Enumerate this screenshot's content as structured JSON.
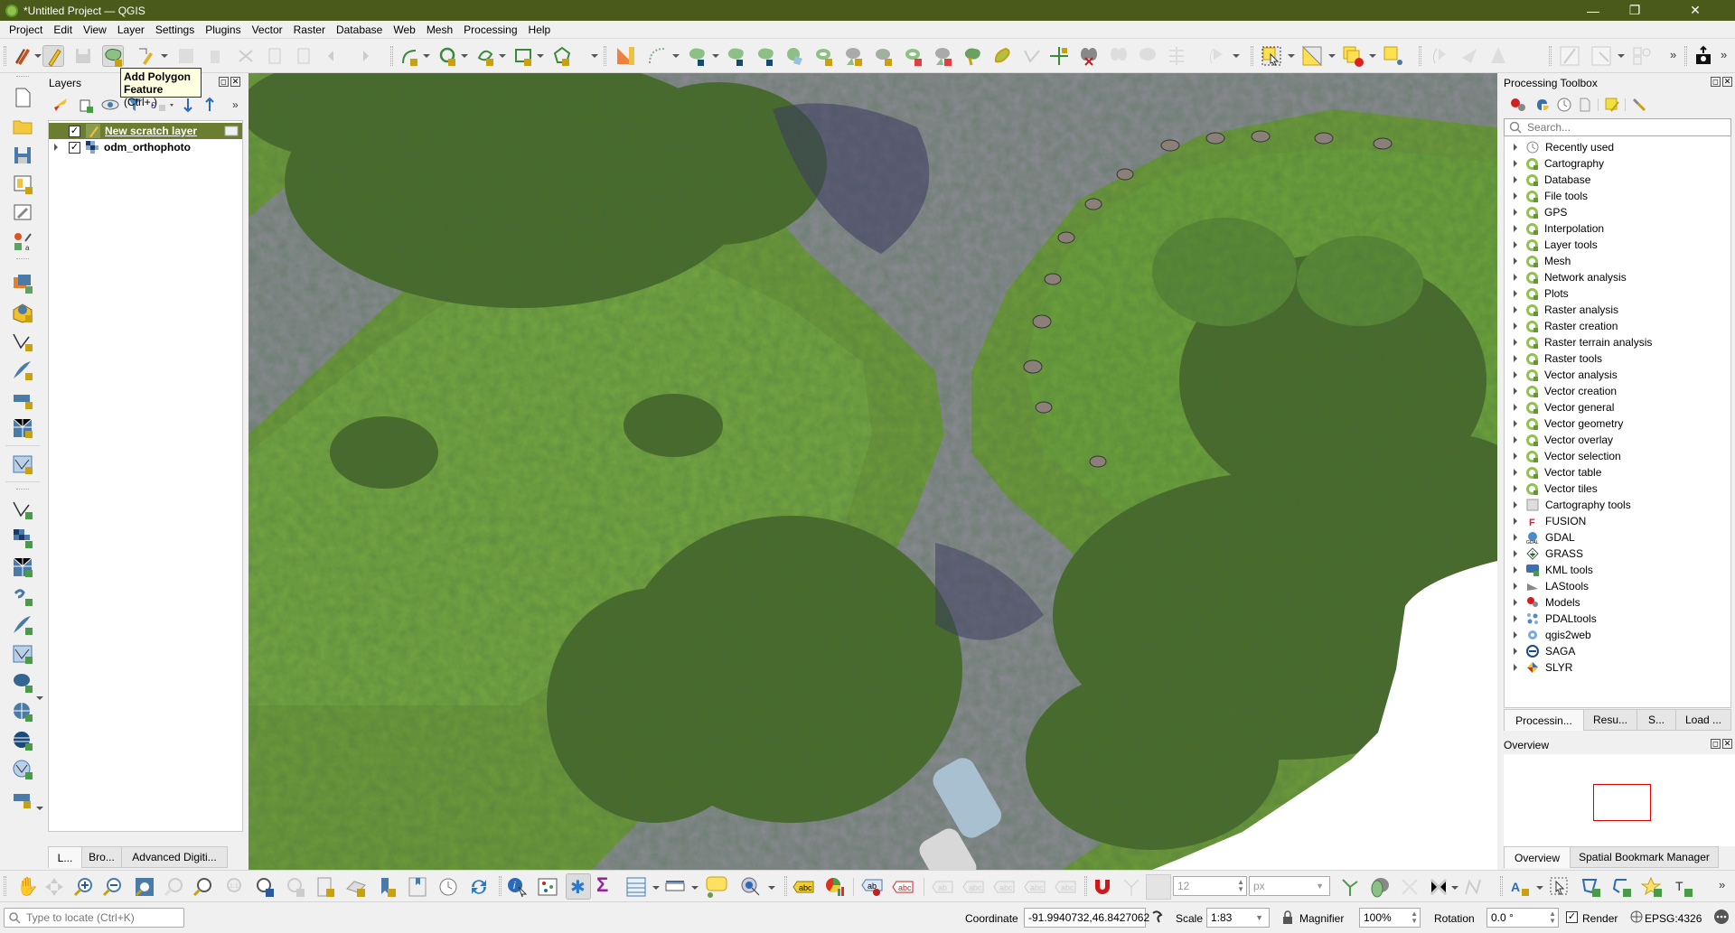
{
  "window": {
    "title": "*Untitled Project — QGIS",
    "controls": [
      "minimize",
      "restore",
      "close"
    ]
  },
  "menu": [
    "Project",
    "Edit",
    "View",
    "Layer",
    "Settings",
    "Plugins",
    "Vector",
    "Raster",
    "Database",
    "Web",
    "Mesh",
    "Processing",
    "Help"
  ],
  "tooltip": {
    "title": "Add Polygon Feature",
    "shortcut": "(Ctrl+.)"
  },
  "toolbar": {
    "icons": [
      "current-edits-icon",
      "toggle-editing-icon",
      "save-layer-edits-icon",
      "add-polygon-feature-icon",
      "vertex-tool-icon",
      "modify-attributes-icon",
      "delete-selected-icon",
      "cut-features-icon",
      "copy-features-icon",
      "paste-features-icon",
      "undo-icon",
      "redo-icon",
      "digitize-with-segment-icon",
      "digitize-with-curve-icon",
      "stream-digitizing-icon",
      "shape-rectangle-icon",
      "shape-regular-polygon-icon",
      "advanced-digitizing-icon",
      "circular-string-icon",
      "move-feature-icon",
      "rotate-feature-icon",
      "simplify-feature-icon",
      "offset-curve-icon",
      "add-ring-icon",
      "add-part-icon",
      "fill-ring-icon",
      "delete-ring-icon",
      "delete-part-icon",
      "reshape-features-icon",
      "offset-icon",
      "reverse-line-icon",
      "trim-extend-icon",
      "split-features-icon",
      "split-parts-icon",
      "merge-features-icon",
      "merge-attributes-icon",
      "rotate-point-symbols-icon",
      "select-features-icon",
      "select-by-value-icon",
      "deselect-all-icon",
      "select-by-location-icon",
      "add-circular-string-icon",
      "rotate-label-icon",
      "change-label-icon",
      "label-toolbar-icon",
      "select-labels-icon",
      "move-labels-icon",
      "more-icon",
      "camera-icon"
    ]
  },
  "layers_panel": {
    "title": "Layers",
    "layers": [
      {
        "name": "New scratch layer",
        "checked": true,
        "editing": true,
        "selected": true
      },
      {
        "name": "odm_orthophoto",
        "checked": true,
        "editing": false,
        "selected": false
      }
    ],
    "tabs": [
      "L...",
      "Bro...",
      "Advanced Digiti..."
    ]
  },
  "processing_toolbox": {
    "title": "Processing Toolbox",
    "search_placeholder": "Search...",
    "items": [
      {
        "label": "Recently used",
        "icon": "clock-icon"
      },
      {
        "label": "Cartography",
        "icon": "qgis-icon"
      },
      {
        "label": "Database",
        "icon": "qgis-icon"
      },
      {
        "label": "File tools",
        "icon": "qgis-icon"
      },
      {
        "label": "GPS",
        "icon": "qgis-icon"
      },
      {
        "label": "Interpolation",
        "icon": "qgis-icon"
      },
      {
        "label": "Layer tools",
        "icon": "qgis-icon"
      },
      {
        "label": "Mesh",
        "icon": "qgis-icon"
      },
      {
        "label": "Network analysis",
        "icon": "qgis-icon"
      },
      {
        "label": "Plots",
        "icon": "qgis-icon"
      },
      {
        "label": "Raster analysis",
        "icon": "qgis-icon"
      },
      {
        "label": "Raster creation",
        "icon": "qgis-icon"
      },
      {
        "label": "Raster terrain analysis",
        "icon": "qgis-icon"
      },
      {
        "label": "Raster tools",
        "icon": "qgis-icon"
      },
      {
        "label": "Vector analysis",
        "icon": "qgis-icon"
      },
      {
        "label": "Vector creation",
        "icon": "qgis-icon"
      },
      {
        "label": "Vector general",
        "icon": "qgis-icon"
      },
      {
        "label": "Vector geometry",
        "icon": "qgis-icon"
      },
      {
        "label": "Vector overlay",
        "icon": "qgis-icon"
      },
      {
        "label": "Vector selection",
        "icon": "qgis-icon"
      },
      {
        "label": "Vector table",
        "icon": "qgis-icon"
      },
      {
        "label": "Vector tiles",
        "icon": "qgis-icon"
      },
      {
        "label": "Cartography tools",
        "icon": "map-icon"
      },
      {
        "label": "FUSION",
        "icon": "fusion-icon"
      },
      {
        "label": "GDAL",
        "icon": "gdal-icon"
      },
      {
        "label": "GRASS",
        "icon": "grass-icon"
      },
      {
        "label": "KML tools",
        "icon": "kml-icon"
      },
      {
        "label": "LAStools",
        "icon": "lastools-icon"
      },
      {
        "label": "Models",
        "icon": "models-icon"
      },
      {
        "label": "PDALtools",
        "icon": "pdal-icon"
      },
      {
        "label": "qgis2web",
        "icon": "qgis2web-icon"
      },
      {
        "label": "SAGA",
        "icon": "saga-icon"
      },
      {
        "label": "SLYR",
        "icon": "slyr-icon"
      }
    ],
    "tabs": [
      "Processin...",
      "Resu...",
      "S...",
      "Load ..."
    ]
  },
  "overview_panel": {
    "title": "Overview",
    "tabs": [
      "Overview",
      "Spatial Bookmark Manager"
    ]
  },
  "snapping": {
    "tolerance": "12",
    "units": "px"
  },
  "statusbar": {
    "locate_placeholder": "Type to locate (Ctrl+K)",
    "coordinate_label": "Coordinate",
    "coordinate_value": "-91.9940732,46.8427062",
    "scale_label": "Scale",
    "scale_value": "1:83",
    "magnifier_label": "Magnifier",
    "magnifier_value": "100%",
    "rotation_label": "Rotation",
    "rotation_value": "0.0 °",
    "render_label": "Render",
    "render_checked": true,
    "crs": "EPSG:4326"
  },
  "colors": {
    "titlebar": "#4a5a1a",
    "selected_layer_row": "#6b7d30",
    "overview_extent": "#e00000",
    "qgis_green": "#8fc34a"
  }
}
